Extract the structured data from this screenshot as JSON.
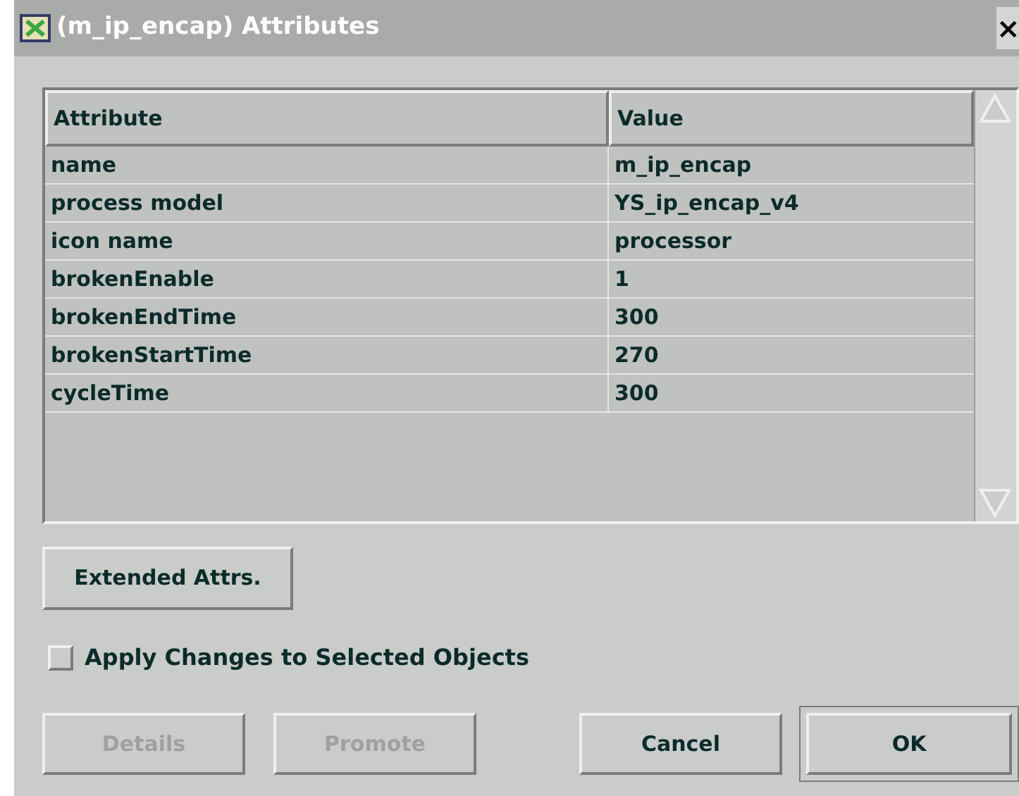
{
  "window": {
    "title": "(m_ip_encap) Attributes",
    "close": "×"
  },
  "table": {
    "columns": [
      "Attribute",
      "Value"
    ],
    "rows": [
      {
        "attribute": "name",
        "value": "m_ip_encap"
      },
      {
        "attribute": "process model",
        "value": "YS_ip_encap_v4"
      },
      {
        "attribute": "icon name",
        "value": "processor"
      },
      {
        "attribute": "brokenEnable",
        "value": "1"
      },
      {
        "attribute": "brokenEndTime",
        "value": "300"
      },
      {
        "attribute": "brokenStartTime",
        "value": "270"
      },
      {
        "attribute": "cycleTime",
        "value": "300"
      }
    ]
  },
  "extended_button": "Extended Attrs.",
  "apply_checkbox": {
    "label": "Apply Changes to Selected Objects",
    "checked": false
  },
  "buttons": [
    {
      "label": "Details",
      "disabled": true,
      "default": false
    },
    {
      "label": "Promote",
      "disabled": true,
      "default": false
    },
    {
      "label": "Cancel",
      "disabled": false,
      "default": false
    },
    {
      "label": "OK",
      "disabled": false,
      "default": true
    }
  ]
}
